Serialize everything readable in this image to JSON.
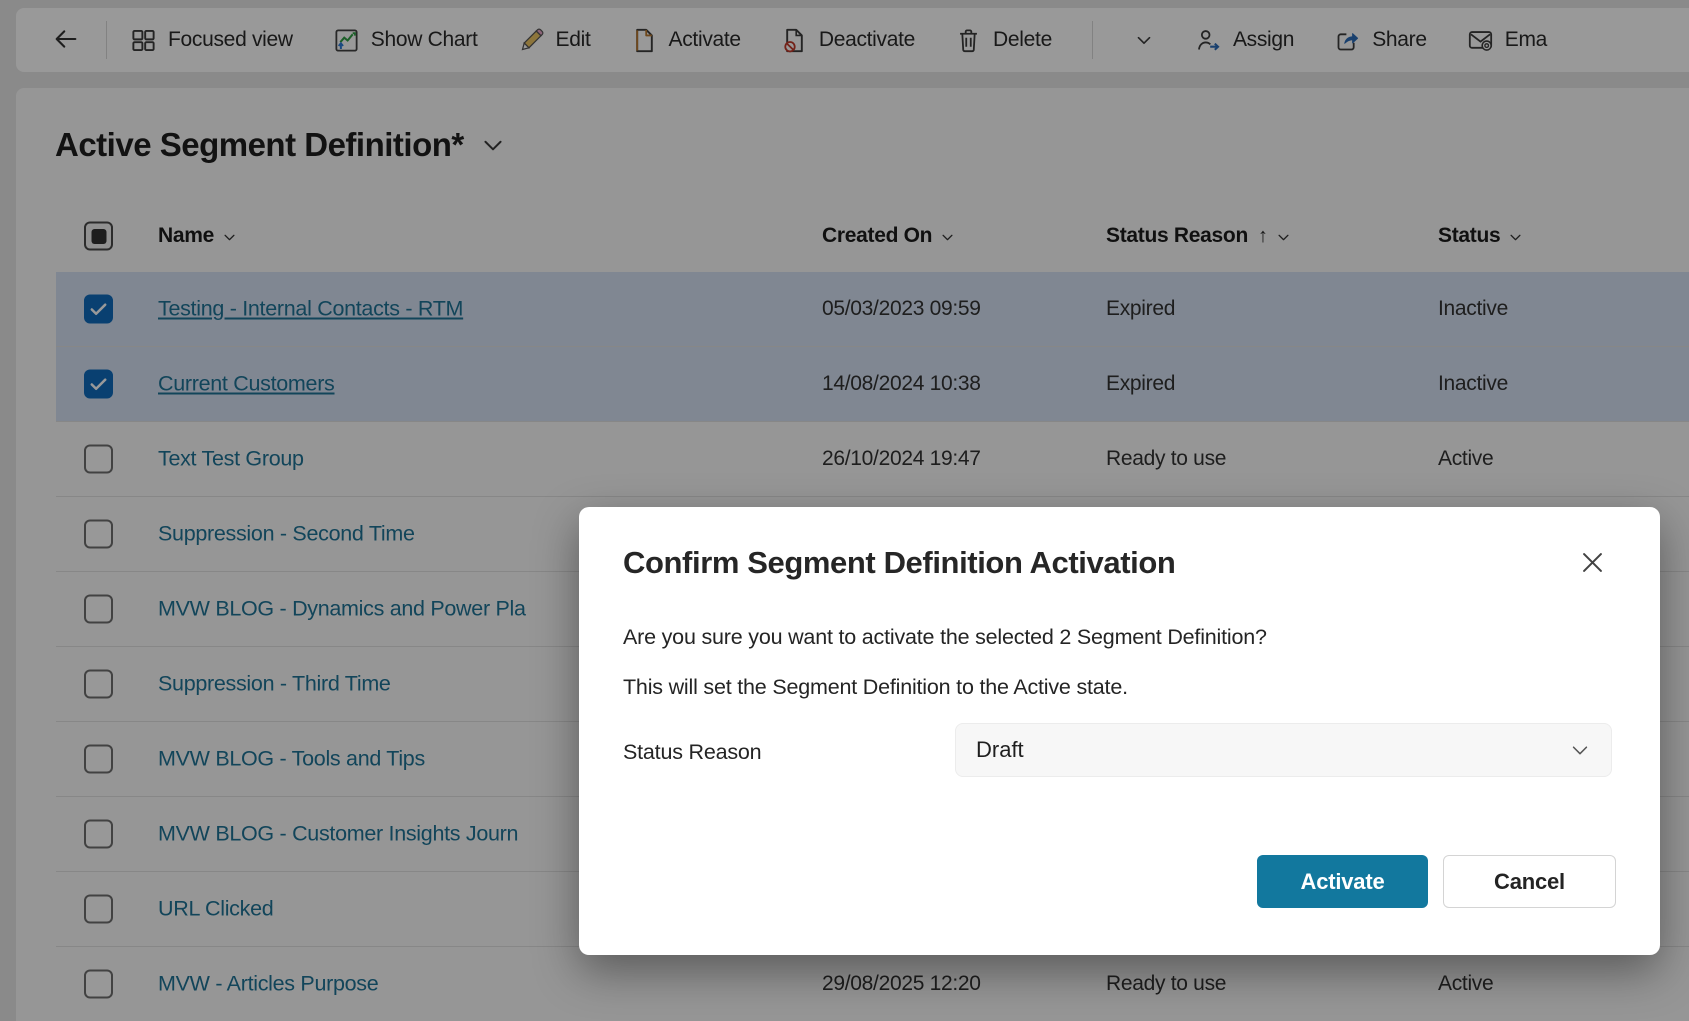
{
  "toolbar": {
    "back_label": "back",
    "items": [
      {
        "type": "button",
        "label": "Focused view",
        "icon": "focused-view-icon"
      },
      {
        "type": "button",
        "label": "Show Chart",
        "icon": "show-chart-icon"
      },
      {
        "type": "button",
        "label": "Edit",
        "icon": "edit-icon"
      },
      {
        "type": "button",
        "label": "Activate",
        "icon": "activate-icon"
      },
      {
        "type": "button",
        "label": "Deactivate",
        "icon": "deactivate-icon"
      },
      {
        "type": "button",
        "label": "Delete",
        "icon": "delete-icon"
      },
      {
        "type": "divider"
      },
      {
        "type": "button",
        "label": "",
        "icon": "chevron-down-icon",
        "name": "more-commands"
      },
      {
        "type": "button",
        "label": "Assign",
        "icon": "assign-icon"
      },
      {
        "type": "button",
        "label": "Share",
        "icon": "share-icon"
      },
      {
        "type": "button",
        "label": "Ema",
        "icon": "email-icon",
        "name": "email",
        "truncated": true
      }
    ]
  },
  "page": {
    "title": "Active Segment Definition*"
  },
  "table": {
    "select_all_state": "indeterminate",
    "columns": [
      {
        "key": "name",
        "label": "Name",
        "sort": null
      },
      {
        "key": "created_on",
        "label": "Created On",
        "sort": null
      },
      {
        "key": "status_reason",
        "label": "Status Reason",
        "sort": "asc"
      },
      {
        "key": "status",
        "label": "Status",
        "sort": null
      }
    ],
    "rows": [
      {
        "name": "Testing - Internal Contacts - RTM",
        "created_on": "05/03/2023 09:59",
        "status_reason": "Expired",
        "status": "Inactive",
        "checked": true
      },
      {
        "name": "Current Customers",
        "created_on": "14/08/2024 10:38",
        "status_reason": "Expired",
        "status": "Inactive",
        "checked": true
      },
      {
        "name": "Text Test Group",
        "created_on": "26/10/2024 19:47",
        "status_reason": "Ready to use",
        "status": "Active",
        "checked": false
      },
      {
        "name": "Suppression - Second Time",
        "created_on": "",
        "status_reason": "",
        "status": "",
        "checked": false
      },
      {
        "name": "MVW BLOG - Dynamics and Power Pla",
        "created_on": "",
        "status_reason": "",
        "status": "",
        "checked": false
      },
      {
        "name": "Suppression - Third Time",
        "created_on": "",
        "status_reason": "",
        "status": "",
        "checked": false
      },
      {
        "name": "MVW BLOG - Tools and Tips",
        "created_on": "",
        "status_reason": "",
        "status": "",
        "checked": false
      },
      {
        "name": "MVW BLOG - Customer Insights Journ",
        "created_on": "",
        "status_reason": "",
        "status": "",
        "checked": false
      },
      {
        "name": "URL Clicked",
        "created_on": "",
        "status_reason": "",
        "status": "",
        "checked": false
      },
      {
        "name": "MVW - Articles Purpose",
        "created_on": "29/08/2025 12:20",
        "status_reason": "Ready to use",
        "status": "Active",
        "checked": false
      }
    ]
  },
  "dialog": {
    "title": "Confirm Segment Definition Activation",
    "message_line1": "Are you sure you want to activate the selected 2 Segment Definition?",
    "message_line2": "This will set the Segment Definition to the Active state.",
    "field_label": "Status Reason",
    "field_value": "Draft",
    "activate_label": "Activate",
    "cancel_label": "Cancel"
  },
  "colors": {
    "primary_button": "#12789e",
    "checkbox_checked": "#0f6cbd",
    "link": "#1f7396",
    "selected_row": "#d6e2f4"
  }
}
